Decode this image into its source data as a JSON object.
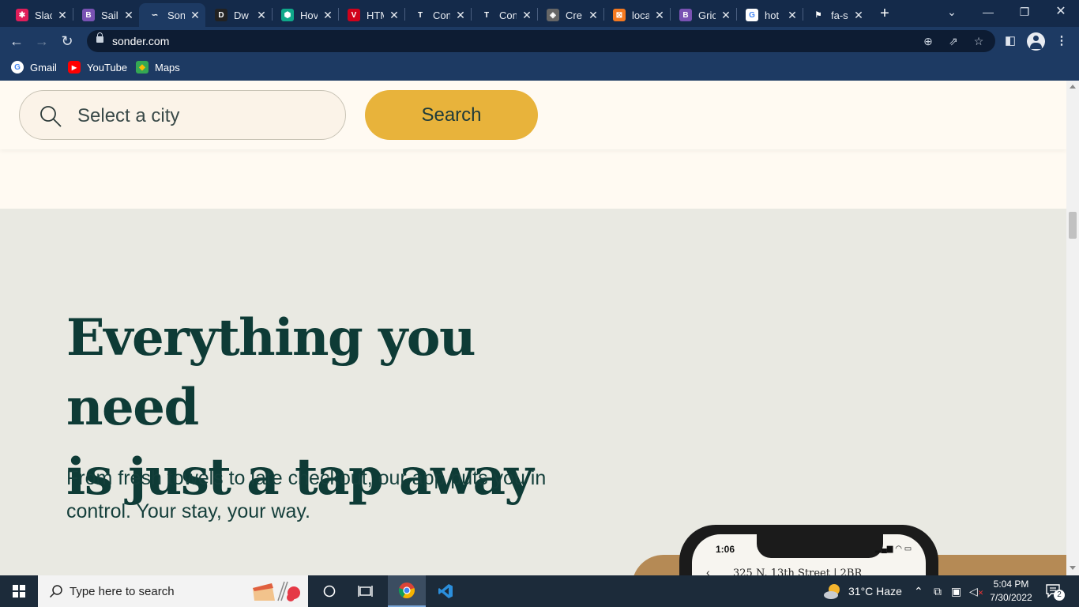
{
  "browser": {
    "tabs": [
      {
        "label": "Slac",
        "favicon_color": "#e01e5a",
        "favicon_glyph": "✱"
      },
      {
        "label": "Sail",
        "favicon_color": "#7952b3",
        "favicon_glyph": "B"
      },
      {
        "label": "Son",
        "favicon_color": "#1d3a63",
        "favicon_glyph": "∽"
      },
      {
        "label": "Dw",
        "favicon_color": "#222222",
        "favicon_glyph": "D"
      },
      {
        "label": "Hov",
        "favicon_color": "#0fa88a",
        "favicon_glyph": "⬢"
      },
      {
        "label": "HTM",
        "favicon_color": "#d0021b",
        "favicon_glyph": "V"
      },
      {
        "label": "Con",
        "favicon_color": "#142a4a",
        "favicon_glyph": "T"
      },
      {
        "label": "Con",
        "favicon_color": "#142a4a",
        "favicon_glyph": "T"
      },
      {
        "label": "Cre",
        "favicon_color": "#666666",
        "favicon_glyph": "◈"
      },
      {
        "label": "loca",
        "favicon_color": "#f47920",
        "favicon_glyph": "⊠"
      },
      {
        "label": "Gric",
        "favicon_color": "#7952b3",
        "favicon_glyph": "B"
      },
      {
        "label": "hot",
        "favicon_color": "#ffffff",
        "favicon_glyph": "G"
      },
      {
        "label": "fa-s",
        "favicon_color": "#142a4a",
        "favicon_glyph": "⚑"
      }
    ],
    "active_tab_index": 2,
    "url": "sonder.com",
    "bookmarks": [
      {
        "label": "Gmail",
        "icon": "google-icon"
      },
      {
        "label": "YouTube",
        "icon": "youtube-icon"
      },
      {
        "label": "Maps",
        "icon": "maps-icon"
      }
    ]
  },
  "page": {
    "search": {
      "placeholder": "Select a city",
      "button_label": "Search"
    },
    "headline_line1": "Everything you need",
    "headline_line2": "is just a tap away",
    "subtext": "From fresh towels to late checkout, our app puts you in control. Your stay, your way.",
    "phone": {
      "time": "1:06",
      "address": "325 N. 13th Street | 2BR"
    },
    "colors": {
      "accent": "#e8b33b",
      "heading": "#0e3b36",
      "band": "#e9e9e2",
      "cream": "#fffaf2"
    }
  },
  "taskbar": {
    "search_placeholder": "Type here to search",
    "weather": "31°C  Haze",
    "time": "5:04 PM",
    "date": "7/30/2022",
    "notifications": "2"
  }
}
